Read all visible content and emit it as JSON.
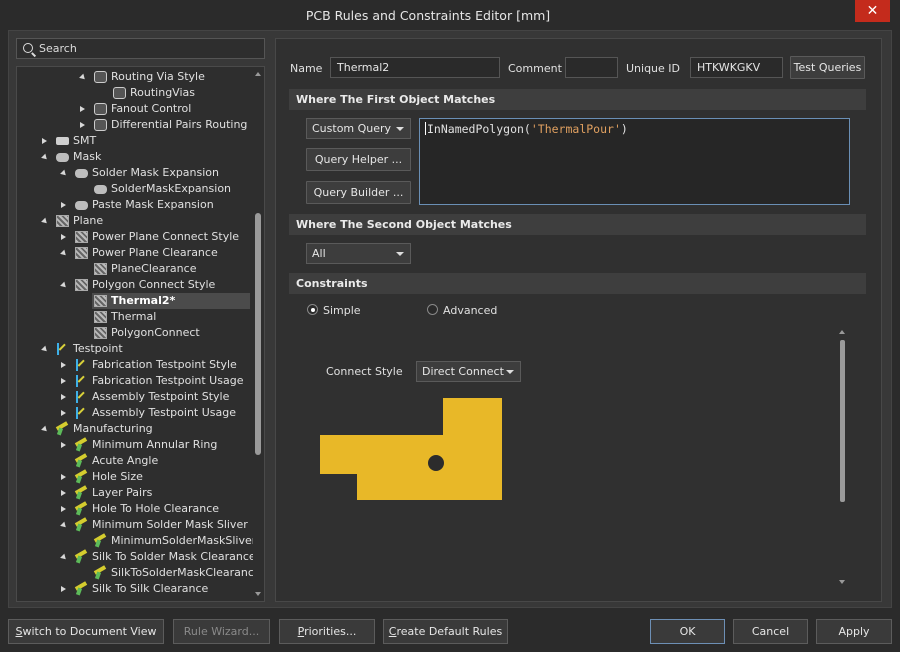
{
  "window": {
    "title": "PCB Rules and Constraints Editor [mm]",
    "close_glyph": "✕"
  },
  "search": {
    "placeholder": "Search"
  },
  "tree": [
    {
      "label": "Routing Via Style",
      "icon": "routing-icon",
      "expand": "expanded"
    },
    {
      "label": "RoutingVias",
      "icon": "routing-icon",
      "expand": "none"
    },
    {
      "label": "Fanout Control",
      "icon": "routing-icon",
      "expand": "collapsed"
    },
    {
      "label": "Differential Pairs Routing",
      "icon": "routing-icon",
      "expand": "collapsed"
    },
    {
      "label": "SMT",
      "icon": "smt-icon",
      "expand": "collapsed"
    },
    {
      "label": "Mask",
      "icon": "mask-icon",
      "expand": "expanded"
    },
    {
      "label": "Solder Mask Expansion",
      "icon": "mask-icon",
      "expand": "expanded"
    },
    {
      "label": "SolderMaskExpansion",
      "icon": "mask-icon",
      "expand": "none"
    },
    {
      "label": "Paste Mask Expansion",
      "icon": "mask-icon",
      "expand": "collapsed"
    },
    {
      "label": "Plane",
      "icon": "plane-icon",
      "expand": "expanded"
    },
    {
      "label": "Power Plane Connect Style",
      "icon": "plane-icon",
      "expand": "collapsed"
    },
    {
      "label": "Power Plane Clearance",
      "icon": "plane-icon",
      "expand": "expanded"
    },
    {
      "label": "PlaneClearance",
      "icon": "plane-icon",
      "expand": "none"
    },
    {
      "label": "Polygon Connect Style",
      "icon": "plane-icon",
      "expand": "expanded"
    },
    {
      "label": "Thermal2*",
      "icon": "plane-icon",
      "expand": "none",
      "selected": true
    },
    {
      "label": "Thermal",
      "icon": "plane-icon",
      "expand": "none"
    },
    {
      "label": "PolygonConnect",
      "icon": "plane-icon",
      "expand": "none"
    },
    {
      "label": "Testpoint",
      "icon": "testpoint-icon",
      "expand": "expanded"
    },
    {
      "label": "Fabrication Testpoint Style",
      "icon": "testpoint-icon",
      "expand": "collapsed"
    },
    {
      "label": "Fabrication Testpoint Usage",
      "icon": "testpoint-icon",
      "expand": "collapsed"
    },
    {
      "label": "Assembly Testpoint Style",
      "icon": "testpoint-icon",
      "expand": "collapsed"
    },
    {
      "label": "Assembly Testpoint Usage",
      "icon": "testpoint-icon",
      "expand": "collapsed"
    },
    {
      "label": "Manufacturing",
      "icon": "manufacturing-icon",
      "expand": "expanded"
    },
    {
      "label": "Minimum Annular Ring",
      "icon": "manufacturing-icon",
      "expand": "collapsed"
    },
    {
      "label": "Acute Angle",
      "icon": "manufacturing-icon",
      "expand": "none"
    },
    {
      "label": "Hole Size",
      "icon": "manufacturing-icon",
      "expand": "collapsed"
    },
    {
      "label": "Layer Pairs",
      "icon": "manufacturing-icon",
      "expand": "collapsed"
    },
    {
      "label": "Hole To Hole Clearance",
      "icon": "manufacturing-icon",
      "expand": "collapsed"
    },
    {
      "label": "Minimum Solder Mask Sliver",
      "icon": "manufacturing-icon",
      "expand": "expanded"
    },
    {
      "label": "MinimumSolderMaskSliver",
      "icon": "manufacturing-icon",
      "expand": "none"
    },
    {
      "label": "Silk To Solder Mask Clearance",
      "icon": "manufacturing-icon",
      "expand": "expanded"
    },
    {
      "label": "SilkToSolderMaskClearance",
      "icon": "manufacturing-icon",
      "expand": "none"
    },
    {
      "label": "Silk To Silk Clearance",
      "icon": "manufacturing-icon",
      "expand": "collapsed"
    }
  ],
  "rule": {
    "name_label": "Name",
    "name_value": "Thermal2",
    "comment_label": "Comment",
    "comment_value": "",
    "uid_label": "Unique ID",
    "uid_value": "HTKWKGKV",
    "test_queries": "Test Queries"
  },
  "first_match": {
    "header": "Where The First Object Matches",
    "dropdown": "Custom Query",
    "query_helper": "Query Helper ...",
    "query_builder": "Query Builder ...",
    "query_fn": "InNamedPolygon(",
    "query_arg": "'ThermalPour'",
    "query_close": ")"
  },
  "second_match": {
    "header": "Where The Second Object Matches",
    "dropdown": "All"
  },
  "constraints": {
    "header": "Constraints",
    "simple": "Simple",
    "advanced": "Advanced",
    "connect_label": "Connect Style",
    "connect_value": "Direct Connect",
    "copper_color": "#e8b828"
  },
  "footer": {
    "switch": "Switch to Document View",
    "wizard": "Rule Wizard...",
    "priorities": "Priorities...",
    "defaults": "Create Default Rules",
    "ok": "OK",
    "cancel": "Cancel",
    "apply": "Apply"
  }
}
